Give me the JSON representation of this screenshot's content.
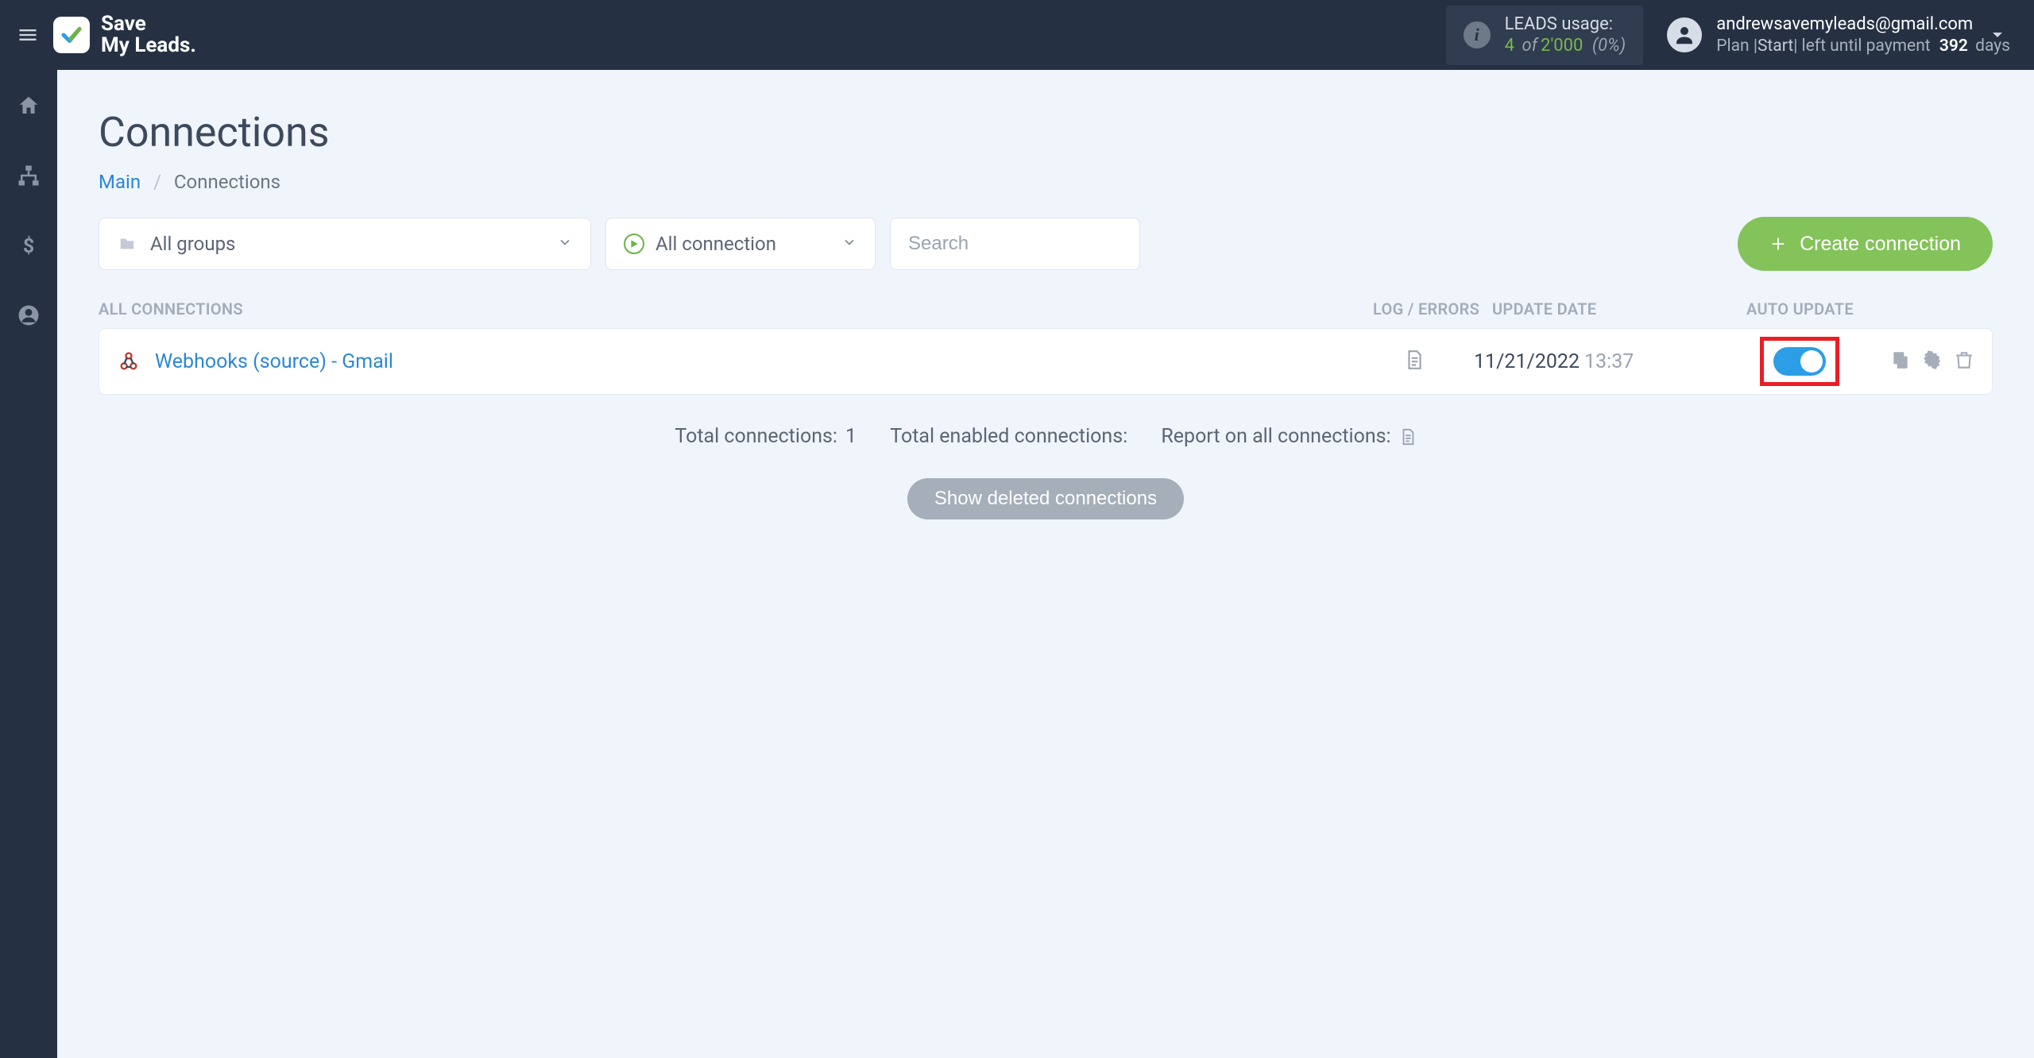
{
  "header": {
    "logo_line1": "Save",
    "logo_line2": "My Leads",
    "usage_label": "LEADS usage:",
    "usage_count": "4",
    "usage_of": "of",
    "usage_total": "2'000",
    "usage_pct": "(0%)",
    "user_email": "andrewsavemyleads@gmail.com",
    "plan_prefix": "Plan |",
    "plan_name": "Start",
    "plan_mid": "| left until payment",
    "plan_days_num": "392",
    "plan_days_unit": "days"
  },
  "page": {
    "title": "Connections",
    "crumb_main": "Main",
    "crumb_current": "Connections"
  },
  "filters": {
    "groups_label": "All groups",
    "conn_label": "All connection",
    "search_placeholder": "Search"
  },
  "create_button": "Create connection",
  "columns": {
    "all": "ALL CONNECTIONS",
    "log": "LOG / ERRORS",
    "update": "UPDATE DATE",
    "auto": "AUTO UPDATE"
  },
  "rows": [
    {
      "name": "Webhooks (source) - Gmail",
      "date": "11/21/2022",
      "time": "13:37",
      "auto_update": true
    }
  ],
  "summary": {
    "total_label": "Total connections:",
    "total_value": "1",
    "enabled_label": "Total enabled connections:",
    "report_label": "Report on all connections:"
  },
  "show_deleted": "Show deleted connections"
}
